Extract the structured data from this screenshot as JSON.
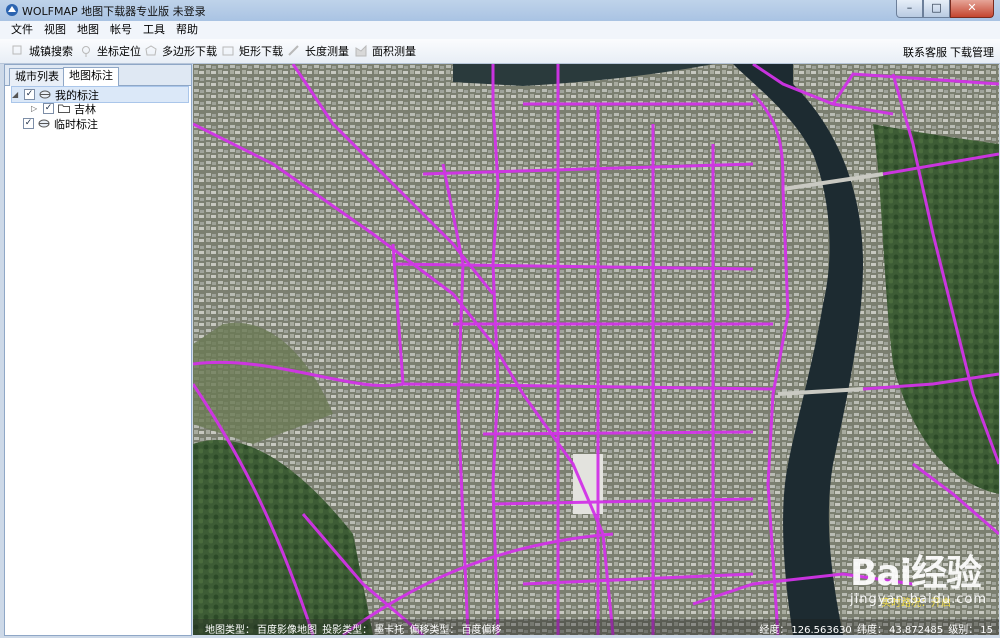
{
  "window": {
    "title": "WOLFMAP 地图下载器专业版   未登录",
    "controls": [
      "minimize",
      "maximize",
      "close"
    ]
  },
  "menu": [
    "文件",
    "视图",
    "地图",
    "帐号",
    "工具",
    "帮助"
  ],
  "toolbar": {
    "tools": [
      {
        "label": "城镇搜索",
        "icon": "search-town-icon"
      },
      {
        "label": "坐标定位",
        "icon": "locate-pin-icon"
      },
      {
        "label": "多边形下载",
        "icon": "polygon-icon"
      },
      {
        "label": "矩形下载",
        "icon": "rectangle-icon"
      },
      {
        "label": "长度测量",
        "icon": "ruler-icon"
      },
      {
        "label": "面积测量",
        "icon": "area-measure-icon"
      }
    ],
    "right": [
      "联系客服",
      "下载管理"
    ]
  },
  "left_panel": {
    "tabs": [
      {
        "label": "城市列表",
        "active": false
      },
      {
        "label": "地图标注",
        "active": true
      }
    ],
    "tree": [
      {
        "label": "我的标注",
        "checked": true,
        "level": 0,
        "selected": true
      },
      {
        "label": "吉林",
        "checked": true,
        "level": 1,
        "selected": false
      },
      {
        "label": "临时标注",
        "checked": true,
        "level": 0,
        "selected": false
      }
    ]
  },
  "map": {
    "status": {
      "map_type_label": "地图类型：",
      "map_type": "百度影像地图",
      "projection_label": "投影类型：",
      "projection": "墨卡托",
      "offset_label": "偏移类型：",
      "offset": "百度偏移",
      "lng_label": "经度：",
      "lng": "126.563630",
      "lat_label": "纬度：",
      "lat": "43.872485",
      "level_label": "级别：",
      "level": "15"
    },
    "realtime_label": "实时路况：开启",
    "watermark": {
      "logo": "Bai经验",
      "sub": "jingyan.baidu.com"
    },
    "colors": {
      "road_overlay": "#d233e8",
      "river": "#1c2a30",
      "forest": "#2e5a2b"
    }
  }
}
